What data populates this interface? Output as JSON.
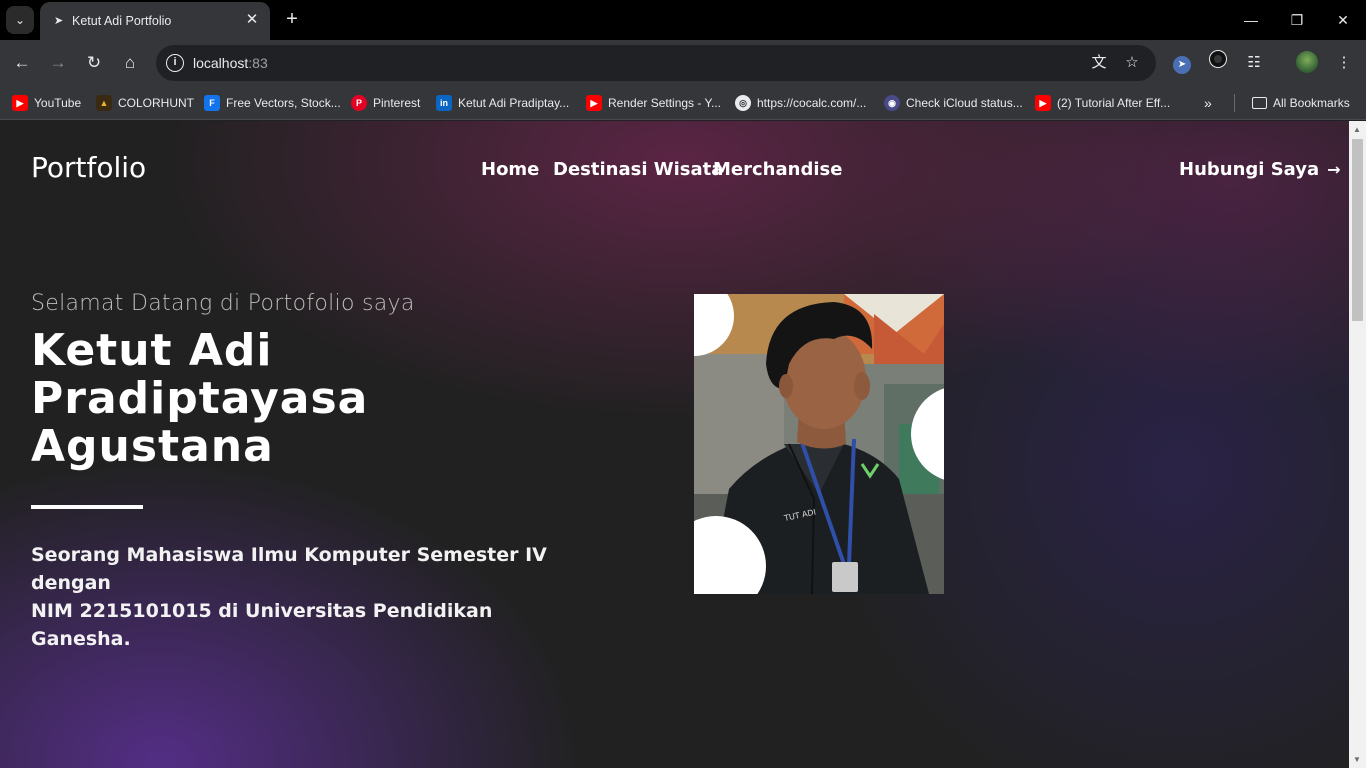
{
  "browser": {
    "tab_title": "Ketut Adi Portfolio",
    "url_host": "localhost",
    "url_port": ":83",
    "bookmarks": [
      {
        "label": "YouTube",
        "icon": "youtube-icon",
        "color": "#ff0000"
      },
      {
        "label": "COLORHUNT",
        "icon": "colorhunt-icon",
        "color": "#e9b72f"
      },
      {
        "label": "Free Vectors, Stock...",
        "icon": "freepik-icon",
        "color": "#1273eb"
      },
      {
        "label": "Pinterest",
        "icon": "pinterest-icon",
        "color": "#e60023"
      },
      {
        "label": "Ketut Adi Pradiptay...",
        "icon": "linkedin-icon",
        "color": "#0a66c2"
      },
      {
        "label": "Render Settings - Y...",
        "icon": "youtube-icon",
        "color": "#ff0000"
      },
      {
        "label": "https://cocalc.com/...",
        "icon": "globe-icon",
        "color": "#e8eaed"
      },
      {
        "label": "Check iCloud status...",
        "icon": "lock-icon",
        "color": "#7a7ae0"
      },
      {
        "label": "(2) Tutorial After Eff...",
        "icon": "youtube-icon",
        "color": "#ff0000"
      }
    ],
    "all_bookmarks": "All Bookmarks"
  },
  "page": {
    "brand": "Portfolio",
    "nav": [
      "Home",
      "Destinasi Wisata",
      "Merchandise"
    ],
    "contact": "Hubungi Saya",
    "welcome": "Selamat Datang di Portofolio saya",
    "name_lines": [
      "Ketut Adi",
      "Pradiptayasa",
      "Agustana"
    ],
    "description_lines": [
      "Seorang Mahasiswa Ilmu Komputer Semester IV dengan",
      "NIM 2215101015 di Universitas Pendidikan Ganesha."
    ],
    "photo_badge": "TUT ADI"
  },
  "colors": {
    "background": "#212121",
    "accent_purple": "#5c3096",
    "accent_magenta": "#6e2650"
  }
}
